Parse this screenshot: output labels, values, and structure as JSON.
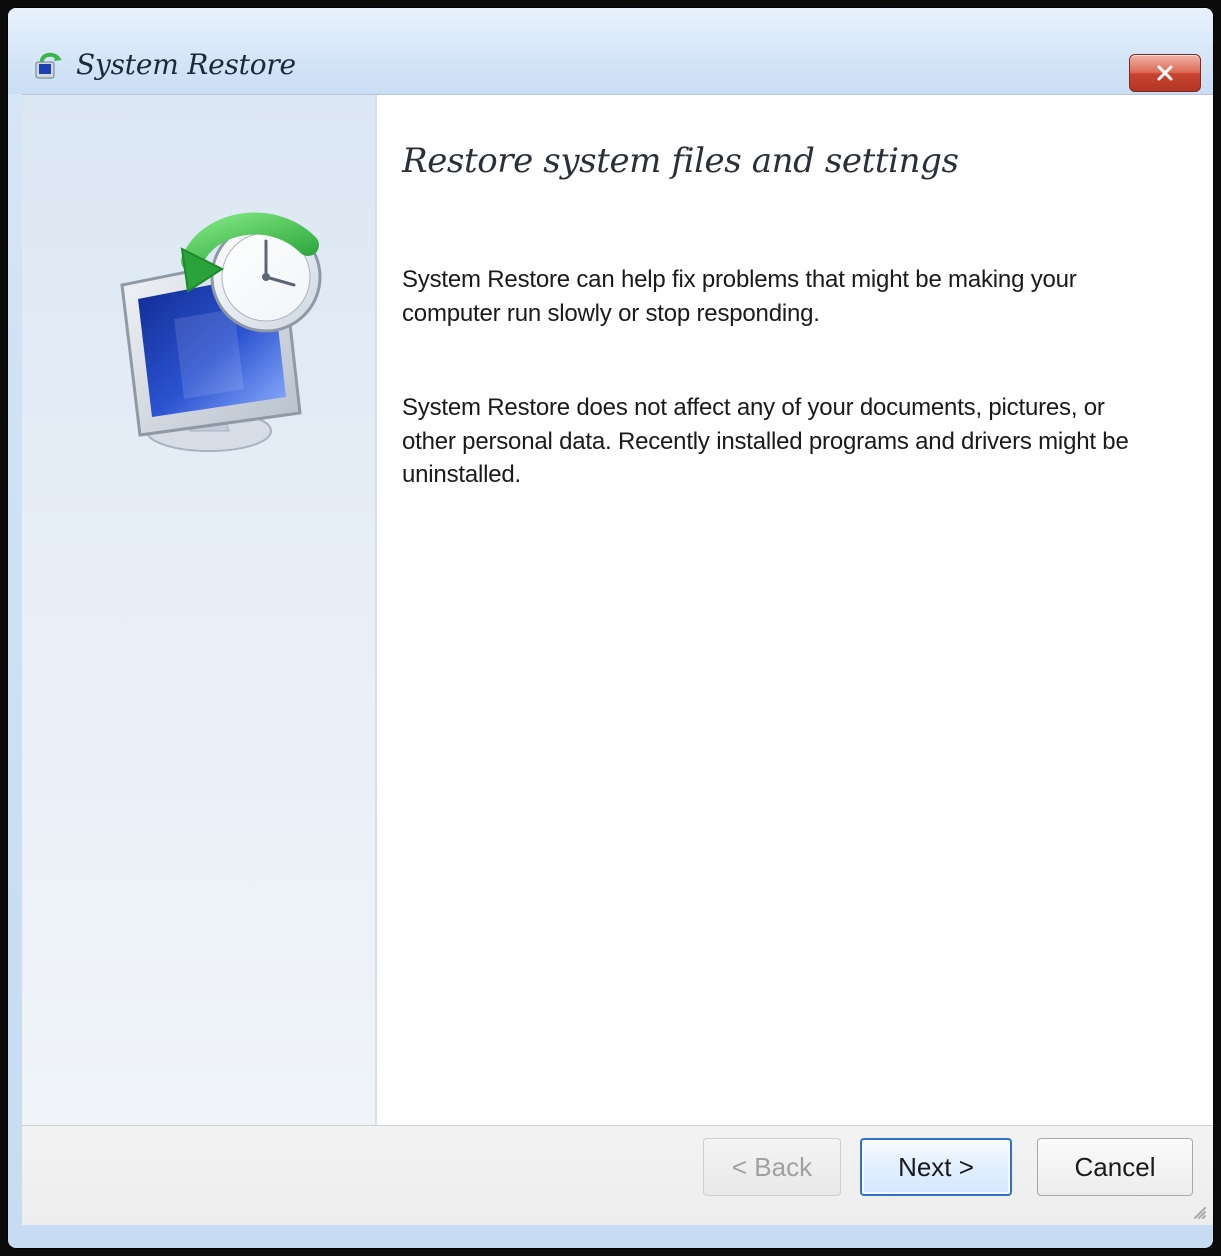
{
  "window": {
    "title": "System Restore",
    "close_label": "×"
  },
  "main": {
    "heading": "Restore system files and settings",
    "paragraph1": "System Restore can help fix problems that might be making your computer run slowly or stop responding.",
    "paragraph2": "System Restore does not affect any of your documents, pictures, or other personal data. Recently installed programs and drivers might be uninstalled."
  },
  "footer": {
    "back_label": "< Back",
    "next_label": "Next >",
    "cancel_label": "Cancel"
  },
  "colors": {
    "accent_blue": "#2f73c9",
    "close_red": "#c7452f",
    "monitor_blue": "#1d3fb0",
    "arrow_green": "#3ab54a"
  },
  "icons": {
    "title": "system-restore-icon",
    "illustration": "system-restore-illustration",
    "close": "close-icon"
  }
}
